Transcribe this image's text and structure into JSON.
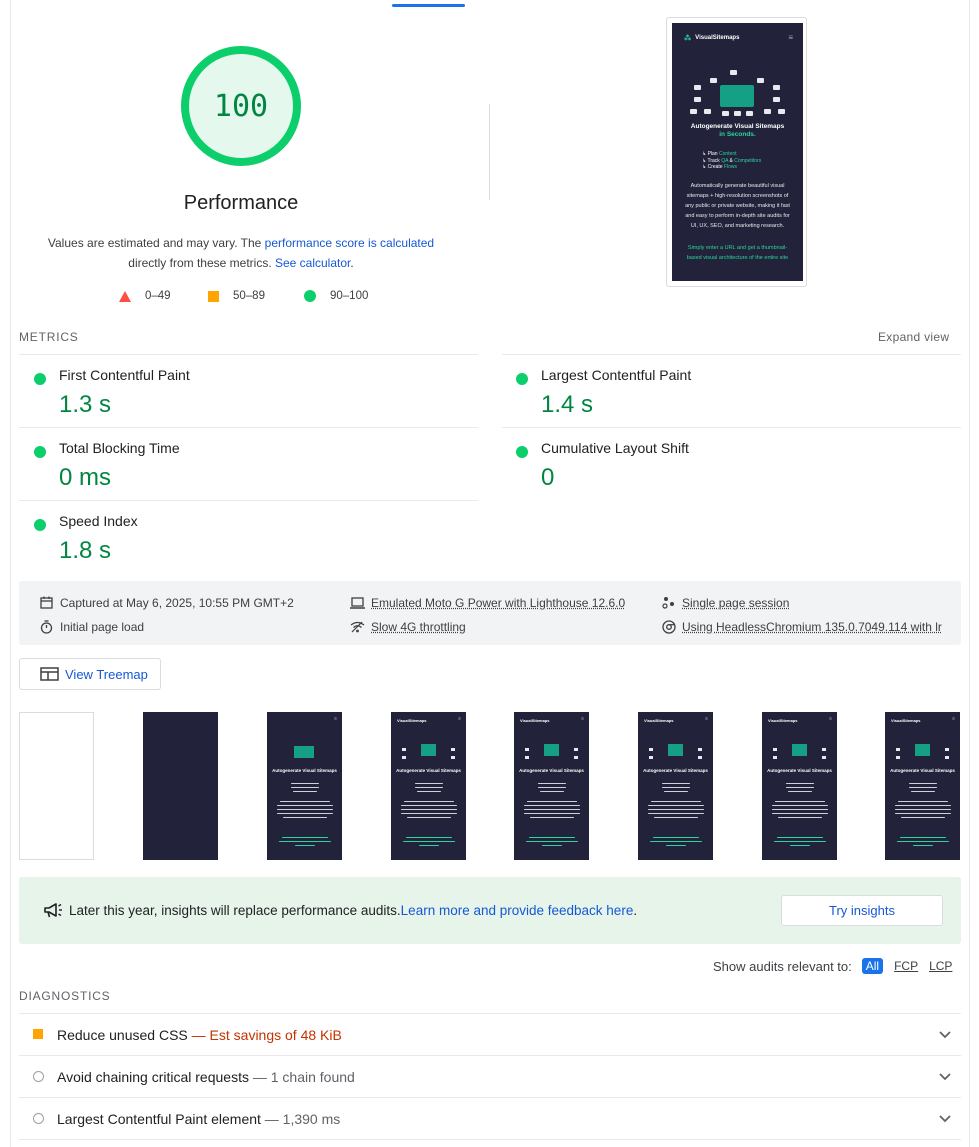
{
  "gauge": {
    "score": "100",
    "label": "Performance",
    "desc_prefix": "Values are estimated and may vary. The ",
    "desc_link1": "performance score is calculated",
    "desc_mid": " directly from these metrics. ",
    "desc_link2": "See calculator",
    "desc_suffix": "."
  },
  "legend": [
    "0–49",
    "50–89",
    "90–100"
  ],
  "screenshot": {
    "brand": "VisualSitemaps",
    "title_line1": "Autogenerate Visual Sitemaps",
    "title_line2": "in Seconds.",
    "bullet1_a": "↳ Plan ",
    "bullet1_b": "Content",
    "bullet2_a": "↳ Track ",
    "bullet2_b": "QA",
    "bullet2_c": " & ",
    "bullet2_d": "Competitors",
    "bullet3_a": "↳ Create ",
    "bullet3_b": "Flows",
    "para": "Automatically generate beautiful visual sitemaps + high-resolution screenshots of any public or private website, making it fast and easy to perform in-depth site audits for UI, UX, SEO, and marketing research.",
    "cta": "Simply enter a URL and get a thumbnail-based visual architecture of the entire site"
  },
  "metrics": {
    "heading": "METRICS",
    "expand": "Expand view",
    "items": [
      {
        "title": "First Contentful Paint",
        "value": "1.3 s"
      },
      {
        "title": "Largest Contentful Paint",
        "value": "1.4 s"
      },
      {
        "title": "Total Blocking Time",
        "value": "0 ms"
      },
      {
        "title": "Cumulative Layout Shift",
        "value": "0"
      },
      {
        "title": "Speed Index",
        "value": "1.8 s"
      }
    ]
  },
  "info": {
    "captured": "Captured at May 6, 2025, 10:55 PM GMT+2",
    "device": "Emulated Moto G Power with Lighthouse 12.6.0",
    "session": "Single page session",
    "load": "Initial page load",
    "throttling": "Slow 4G throttling",
    "browser": "Using HeadlessChromium 135.0.7049.114 with lr"
  },
  "treemap": "View Treemap",
  "filmstrip_frame_title": "Autogenerate Visual Sitemaps",
  "insights": {
    "text": "Later this year, insights will replace performance audits. ",
    "link": "Learn more and provide feedback here",
    "suffix": ".",
    "button": "Try insights"
  },
  "filter": {
    "label": "Show audits relevant to:",
    "all": "All",
    "fcp": "FCP",
    "lcp": "LCP"
  },
  "diagnostics": {
    "heading": "DIAGNOSTICS",
    "items": [
      {
        "title": "Reduce unused CSS",
        "detail": " — Est savings of 48 KiB"
      },
      {
        "title": "Avoid chaining critical requests",
        "detail": " — 1 chain found"
      },
      {
        "title": "Largest Contentful Paint element",
        "detail": " — 1,390 ms"
      }
    ]
  },
  "colors": {
    "pass": "#0cce6b",
    "pass_text": "#018642",
    "average": "#ffa400",
    "fail": "#ff4e42",
    "link": "#1558d6"
  }
}
